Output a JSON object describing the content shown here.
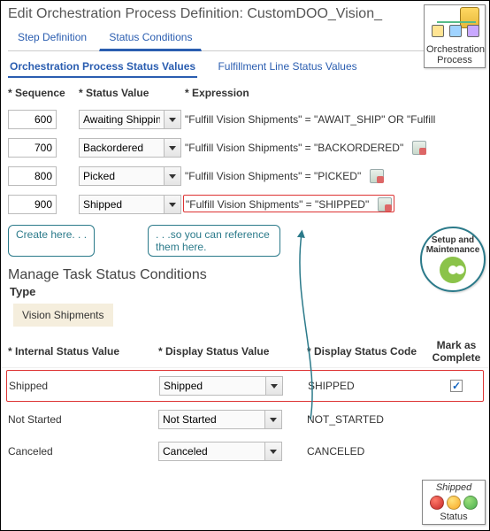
{
  "header": {
    "title": "Edit Orchestration Process Definition: CustomDOO_Vision_",
    "tabs": [
      {
        "label": "Step Definition",
        "active": false
      },
      {
        "label": "Status Conditions",
        "active": true
      }
    ],
    "subtabs": [
      {
        "label": "Orchestration Process Status Values",
        "active": true
      },
      {
        "label": "Fulfillment Line Status Values",
        "active": false
      }
    ]
  },
  "upper_table": {
    "columns": {
      "sequence": "Sequence",
      "status_value": "Status Value",
      "expression": "Expression"
    },
    "rows": [
      {
        "sequence": "600",
        "status": "Awaiting Shipping",
        "expression": "\"Fulfill Vision Shipments\" = \"AWAIT_SHIP\" OR \"Fulfill"
      },
      {
        "sequence": "700",
        "status": "Backordered",
        "expression": "\"Fulfill Vision Shipments\" = \"BACKORDERED\""
      },
      {
        "sequence": "800",
        "status": "Picked",
        "expression": "\"Fulfill Vision Shipments\" = \"PICKED\""
      },
      {
        "sequence": "900",
        "status": "Shipped",
        "expression": "\"Fulfill Vision Shipments\" = \"SHIPPED\"",
        "highlight": true
      }
    ]
  },
  "callouts": {
    "create": "Create here. . .",
    "reference": ". . .so you can reference them here."
  },
  "lower_section": {
    "title": "Manage Task Status Conditions",
    "type_label": "Type",
    "type_value": "Vision Shipments",
    "columns": {
      "internal": "Internal Status Value",
      "display": "Display Status Value",
      "code": "Display Status Code",
      "mark": "Mark as Complete"
    },
    "rows": [
      {
        "internal": "Shipped",
        "display": "Shipped",
        "code": "SHIPPED",
        "mark": true,
        "highlight": true
      },
      {
        "internal": "Not Started",
        "display": "Not Started",
        "code": "NOT_STARTED",
        "mark": false
      },
      {
        "internal": "Canceled",
        "display": "Canceled",
        "code": "CANCELED",
        "mark": false
      }
    ]
  },
  "badges": {
    "orchestration": "Orchestration Process",
    "setup": "Setup and Maintenance",
    "status_title": "Shipped",
    "status_label": "Status"
  }
}
